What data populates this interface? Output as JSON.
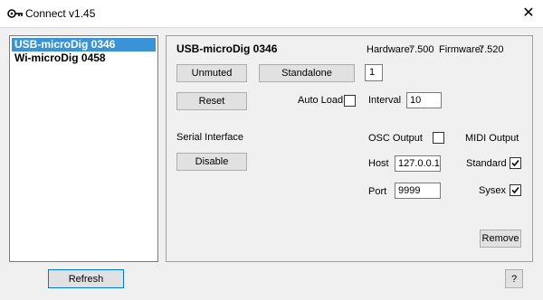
{
  "window": {
    "title": "Connect v1.45",
    "close_glyph": "✕",
    "icon": "connect-icon"
  },
  "devices": [
    "USB-microDig 0346",
    "Wi-microDig 0458"
  ],
  "selected_device": "USB-microDig 0346",
  "panel": {
    "device_name": "USB-microDig 0346",
    "hardware_label": "Hardware:",
    "hardware_value": "7.500",
    "firmware_label": "Firmware:",
    "firmware_value": "7.520",
    "unmuted_label": "Unmuted",
    "standalone_label": "Standalone",
    "standalone_value": "1",
    "reset_label": "Reset",
    "auto_load_label": "Auto Load",
    "auto_load_checked": false,
    "interval_label": "Interval",
    "interval_value": "10",
    "serial_interface_label": "Serial Interface",
    "disable_label": "Disable",
    "osc_output_label": "OSC Output",
    "osc_output_checked": false,
    "midi_output_label": "MIDI Output",
    "host_label": "Host",
    "host_value": "127.0.0.1",
    "standard_label": "Standard",
    "standard_checked": true,
    "port_label": "Port",
    "port_value": "9999",
    "sysex_label": "Sysex",
    "sysex_checked": true,
    "remove_label": "Remove"
  },
  "footer": {
    "refresh_label": "Refresh",
    "help_label": "?"
  }
}
